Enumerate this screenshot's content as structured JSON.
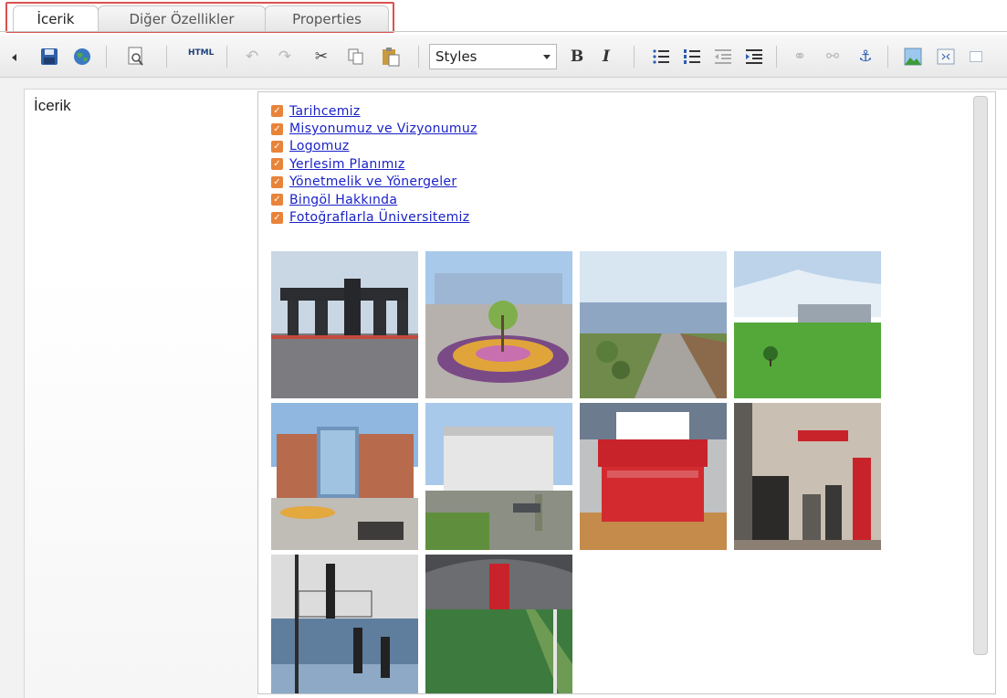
{
  "tabs": [
    {
      "label": "İcerik"
    },
    {
      "label": "Diğer Özellikler"
    },
    {
      "label": "Properties"
    }
  ],
  "toolbar": {
    "html_label": "HTML",
    "styles_value": "Styles",
    "bold_label": "B",
    "italic_label": "I"
  },
  "form": {
    "content_label": "İcerik"
  },
  "links": [
    "Tarihcemiz",
    "Misyonumuz ve Vizyonumuz",
    "Logomuz",
    "Yerlesim Planımız",
    "Yönetmelik ve Yönergeler",
    "Bingöl Hakkında",
    "Fotoğraflarla Üniversitemiz"
  ],
  "colors": {
    "checkbox": "#e8843a",
    "link": "#1a22c8",
    "tab_highlight": "#d9534f"
  }
}
